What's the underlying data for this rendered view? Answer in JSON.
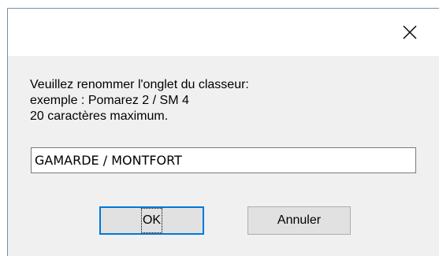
{
  "dialog": {
    "close_label": "✕",
    "message": {
      "line1": "Veuillez renommer l'onglet du classeur:",
      "line2": "exemple  : Pomarez 2 / SM 4",
      "line3": "20 caractères maximum."
    },
    "input": {
      "value": "GAMARDE / MONTFORT"
    },
    "buttons": {
      "ok_label": "OK",
      "cancel_label": "Annuler"
    }
  }
}
